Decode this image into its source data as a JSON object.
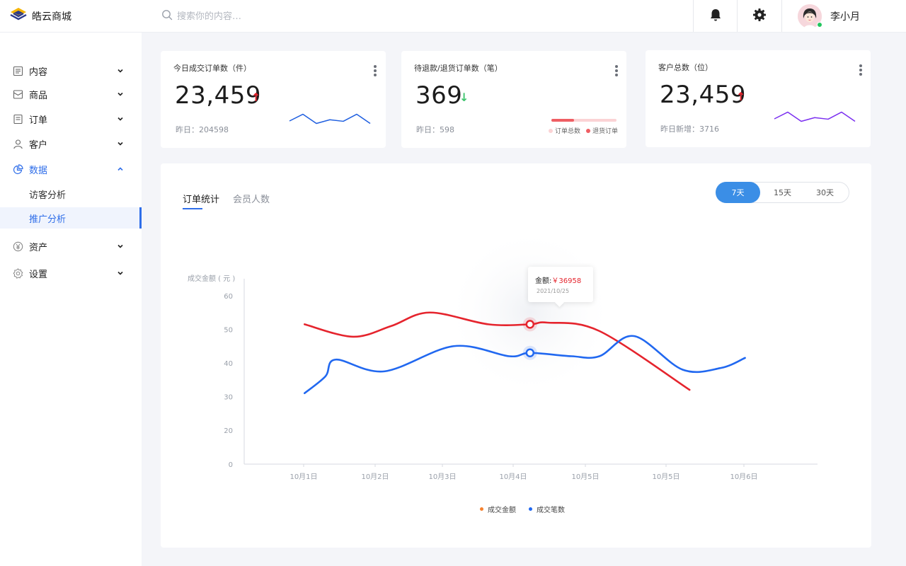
{
  "app": {
    "name": "皓云商城"
  },
  "search": {
    "placeholder": "搜索你的内容…"
  },
  "header": {
    "icons": [
      "bell-icon",
      "gear-icon"
    ],
    "user_name": "李小月"
  },
  "sidebar": {
    "items": [
      {
        "label": "内容",
        "icon": "document-icon",
        "expanded": false
      },
      {
        "label": "商品",
        "icon": "box-icon",
        "expanded": false
      },
      {
        "label": "订单",
        "icon": "order-icon",
        "expanded": false
      },
      {
        "label": "客户",
        "icon": "user-icon",
        "expanded": false
      },
      {
        "label": "数据",
        "icon": "pie-chart-icon",
        "expanded": true,
        "active": true,
        "children": [
          {
            "label": "访客分析",
            "selected": false
          },
          {
            "label": "推广分析",
            "selected": true
          }
        ]
      },
      {
        "label": "资产",
        "icon": "yen-icon",
        "expanded": false
      },
      {
        "label": "设置",
        "icon": "settings-icon",
        "expanded": false
      }
    ]
  },
  "cards": [
    {
      "title": "今日成交订单数（件）",
      "value": "23,459",
      "trend": "up",
      "sub": "昨日：204598",
      "spark": [
        30,
        52,
        22,
        34,
        29,
        52,
        22
      ],
      "color": "#1f5fe0"
    },
    {
      "title": "待退款/退货订单数（笔）",
      "value": "369",
      "trend": "down",
      "sub": "昨日：598",
      "progress": {
        "total_label": "订单总数",
        "return_label": "退货订单",
        "return_fraction": 0.35
      }
    },
    {
      "title": "客户总数（位）",
      "value": "23,459",
      "trend": "up",
      "sub": "昨日新增：3716",
      "spark": [
        30,
        52,
        22,
        34,
        29,
        52,
        22
      ],
      "color": "#7b2ff0"
    }
  ],
  "panel": {
    "tabs": [
      {
        "label": "订单统计",
        "active": true
      },
      {
        "label": "会员人数",
        "active": false
      }
    ],
    "ranges": [
      {
        "label": "7天",
        "active": true
      },
      {
        "label": "15天",
        "active": false
      },
      {
        "label": "30天",
        "active": false
      }
    ],
    "tooltip": {
      "label": "金额:",
      "value": "￥36958",
      "date": "2021/10/25"
    }
  },
  "chart_data": {
    "type": "line",
    "ylabel": "成交金额 ( 元 )",
    "yticks": [
      0,
      20,
      30,
      40,
      50,
      60
    ],
    "xticks": [
      "10月1日",
      "10月2日",
      "10月3日",
      "10月4日",
      "10月5日",
      "10月5日",
      "10月6日"
    ],
    "series": [
      {
        "name": "成交金额",
        "color": "#e5242d",
        "marker_color": "#f5812e",
        "points": [
          [
            0.35,
            51.5
          ],
          [
            1.05,
            47.8
          ],
          [
            1.6,
            51
          ],
          [
            2.15,
            55
          ],
          [
            3.0,
            51.5
          ],
          [
            3.6,
            51.5
          ],
          [
            3.85,
            52
          ],
          [
            4.6,
            49.5
          ],
          [
            5.9,
            32
          ]
        ]
      },
      {
        "name": "成交笔数",
        "color": "#2168f0",
        "marker_color": "#2168f0",
        "points": [
          [
            0.35,
            31
          ],
          [
            0.65,
            36
          ],
          [
            0.8,
            41
          ],
          [
            1.5,
            37.5
          ],
          [
            2.5,
            45
          ],
          [
            3.3,
            42
          ],
          [
            3.6,
            43
          ],
          [
            4.2,
            42
          ],
          [
            4.6,
            42
          ],
          [
            5.1,
            48
          ],
          [
            5.8,
            38
          ],
          [
            6.35,
            38.5
          ],
          [
            6.7,
            41.5
          ]
        ]
      }
    ],
    "highlight": {
      "x": 3.6,
      "series_values": [
        51.5,
        43
      ]
    }
  }
}
